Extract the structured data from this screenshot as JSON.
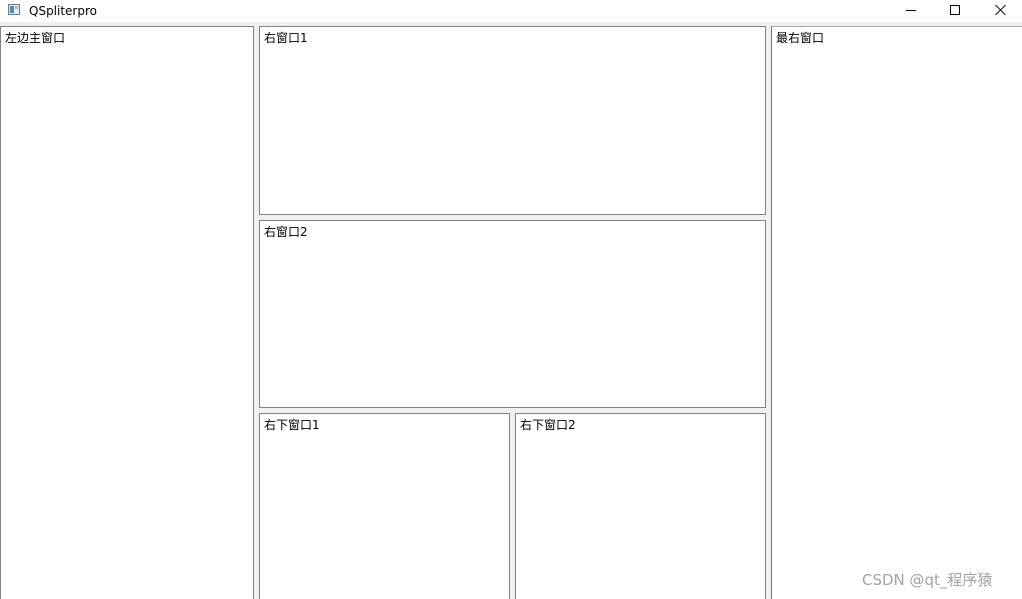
{
  "window": {
    "title": "QSpliterpro"
  },
  "panes": {
    "left": "左边主窗口",
    "right1": "右窗口1",
    "right2": "右窗口2",
    "right_bottom1": "右下窗口1",
    "right_bottom2": "右下窗口2",
    "far_right": "最右窗口"
  },
  "icons": {
    "app": "app-window-icon",
    "minimize": "minimize-icon",
    "maximize": "maximize-icon",
    "close": "close-icon"
  },
  "watermark": "CSDN @qt_程序猿"
}
